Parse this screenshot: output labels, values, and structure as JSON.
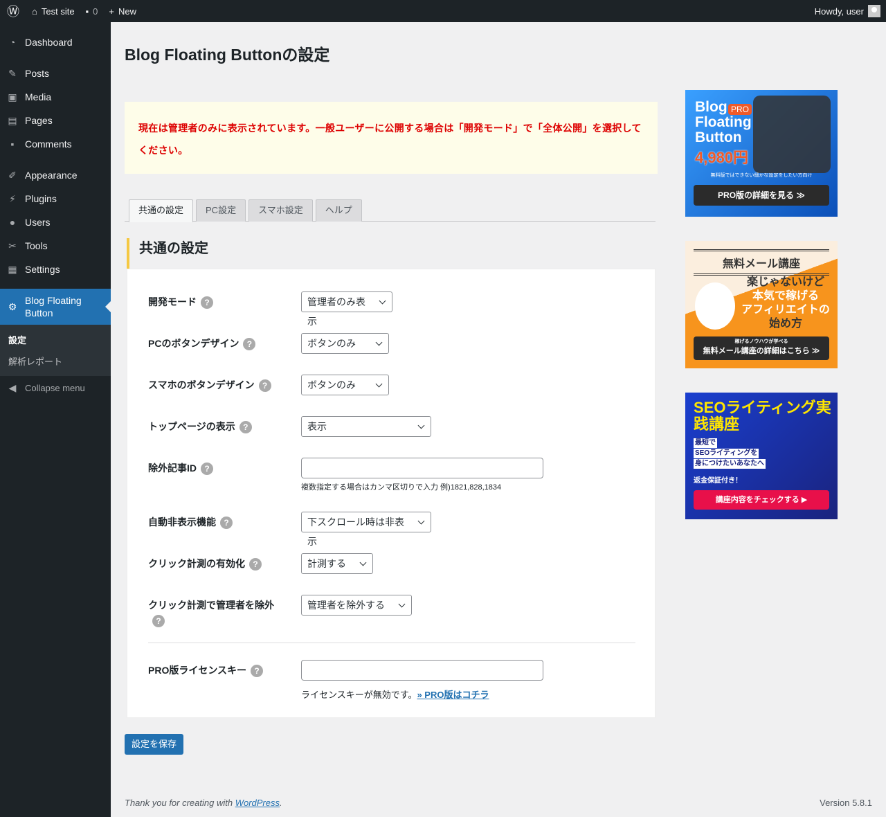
{
  "adminbar": {
    "site": "Test site",
    "comments": "0",
    "new": "New",
    "howdy": "Howdy, user"
  },
  "sidebar": {
    "items": [
      {
        "label": "Dashboard",
        "icon": "dashboard-icon"
      },
      {
        "label": "Posts",
        "icon": "pin-icon"
      },
      {
        "label": "Media",
        "icon": "media-icon"
      },
      {
        "label": "Pages",
        "icon": "pages-icon"
      },
      {
        "label": "Comments",
        "icon": "comment-icon"
      },
      {
        "label": "Appearance",
        "icon": "brush-icon"
      },
      {
        "label": "Plugins",
        "icon": "plugin-icon"
      },
      {
        "label": "Users",
        "icon": "user-icon"
      },
      {
        "label": "Tools",
        "icon": "wrench-icon"
      },
      {
        "label": "Settings",
        "icon": "settings-icon"
      }
    ],
    "active": "Blog Floating Button",
    "submenu": [
      "設定",
      "解析レポート"
    ],
    "collapse": "Collapse menu"
  },
  "page": {
    "title": "Blog Floating Buttonの設定",
    "notice": "現在は管理者のみに表示されています。一般ユーザーに公開する場合は「開発モード」で「全体公開」を選択してください。",
    "tabs": [
      "共通の設定",
      "PC設定",
      "スマホ設定",
      "ヘルプ"
    ],
    "section": "共通の設定",
    "fields": [
      {
        "label": "開発モード",
        "value": "管理者のみ表示"
      },
      {
        "label": "PCのボタンデザイン",
        "value": "ボタンのみ"
      },
      {
        "label": "スマホのボタンデザイン",
        "value": "ボタンのみ"
      },
      {
        "label": "トップページの表示",
        "value": "表示"
      },
      {
        "label": "除外記事ID",
        "value": "",
        "note": "複数指定する場合はカンマ区切りで入力 例)1821,828,1834"
      },
      {
        "label": "自動非表示機能",
        "value": "下スクロール時は非表示"
      },
      {
        "label": "クリック計測の有効化",
        "value": "計測する"
      },
      {
        "label": "クリック計測で管理者を除外",
        "value": "管理者を除外する"
      }
    ],
    "license": {
      "label": "PRO版ライセンスキー",
      "value": "",
      "note": "ライセンスキーが無効です。",
      "link": "» PRO版はコチラ"
    },
    "save": "設定を保存",
    "footer": {
      "text": "Thank you for creating with ",
      "link": "WordPress",
      "version": "Version 5.8.1"
    }
  },
  "banners": {
    "pro": {
      "title": "Blog Floating Button",
      "badge": "PRO",
      "price": "4,980円",
      "sub": "無料版ではできない細かな設定をしたい方向け",
      "cta": "PRO版の詳細を見る ≫"
    },
    "mail": {
      "title": "無料メール講座",
      "lines": [
        "楽じゃないけど",
        "本気で稼げる",
        "アフィリエイトの",
        "始め方"
      ],
      "sub": "稼げるノウハウが学べる",
      "cta": "無料メール講座の詳細はこちら ≫"
    },
    "seo": {
      "title": "SEOライティング実践講座",
      "lines": [
        "最短で",
        "SEOライティングを",
        "身につけたいあなたへ"
      ],
      "sub": "返金保証付き！",
      "cta": "講座内容をチェックする ▶"
    }
  },
  "colors": {
    "accent": "#2271b1",
    "notice_text": "#dd0000",
    "sidebar": "#1d2327"
  }
}
